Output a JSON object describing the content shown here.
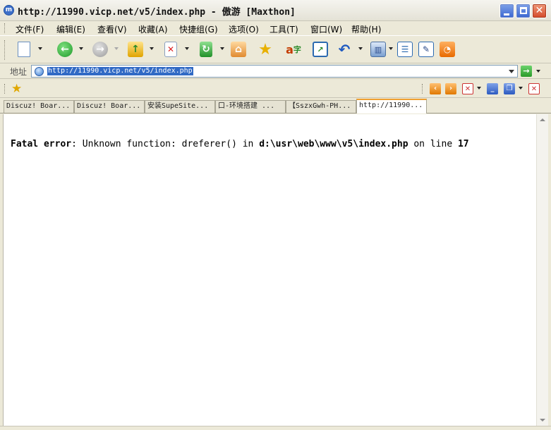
{
  "window": {
    "title": "http://11990.vicp.net/v5/index.php - 傲游 [Maxthon]",
    "logo_letter": "m"
  },
  "menu": {
    "items": [
      {
        "label": "文件(F)"
      },
      {
        "label": "编辑(E)"
      },
      {
        "label": "查看(V)"
      },
      {
        "label": "收藏(A)"
      },
      {
        "label": "快捷组(G)"
      },
      {
        "label": "选项(O)"
      },
      {
        "label": "工具(T)"
      },
      {
        "label": "窗口(W)"
      },
      {
        "label": "帮助(H)"
      }
    ]
  },
  "toolbar": {
    "icons": [
      "new-page-icon",
      "back-icon",
      "forward-icon",
      "up-folder-icon",
      "stop-icon",
      "refresh-icon",
      "home-icon",
      "favorites-star-icon",
      "translate-icon",
      "screen-capture-icon",
      "undo-icon",
      "filter-icon",
      "sidebar-icon",
      "edit-icon",
      "rss-icon"
    ]
  },
  "address": {
    "label": "地址",
    "url": "http://11990.vicp.net/v5/index.php"
  },
  "tabs": [
    {
      "label": "Discuz! Boar..."
    },
    {
      "label": "Discuz! Boar..."
    },
    {
      "label": "安装SupeSite..."
    },
    {
      "label": "口-环境搭建 ..."
    },
    {
      "label": "【SszxGwh-PH..."
    },
    {
      "label": "http://11990..."
    }
  ],
  "content": {
    "error_prefix": "Fatal error",
    "error_message": ": Unknown function: dreferer() in ",
    "error_path": "d:\\usr\\web\\www\\v5\\index.php",
    "error_on_line": " on line ",
    "error_line_number": "17"
  },
  "colors": {
    "selection": "#316ac5",
    "active_tab_accent": "#f0a030",
    "chrome": "#ece9d8"
  }
}
